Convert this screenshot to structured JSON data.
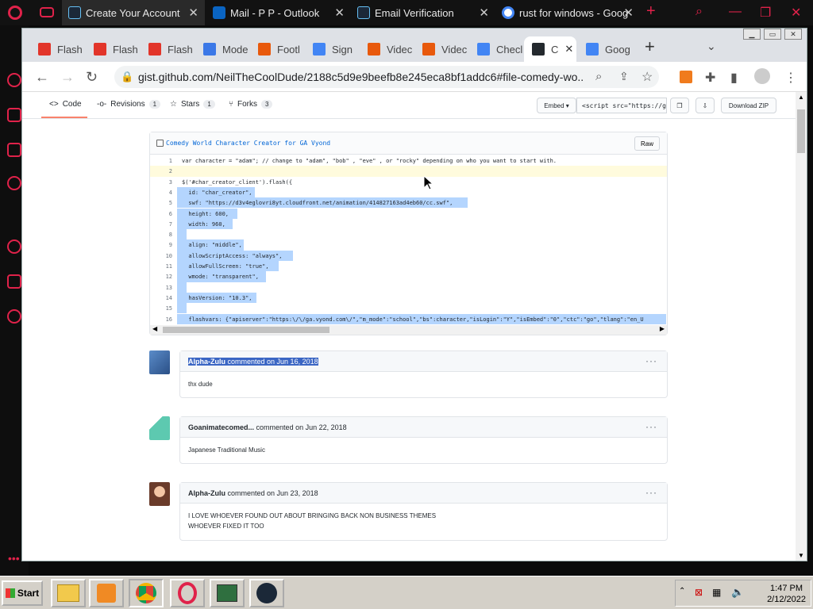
{
  "opera": {
    "tabs": [
      {
        "title": "Create Your Account",
        "favicon": "steam-icon",
        "active": true
      },
      {
        "title": "Mail - P P - Outlook",
        "favicon": "outlook-icon"
      },
      {
        "title": "Email Verification",
        "favicon": "steam-icon"
      },
      {
        "title": "rust for windows - Goog",
        "favicon": "google-icon"
      }
    ],
    "new_tab": "+"
  },
  "chrome": {
    "tabs": [
      {
        "title": "Flash",
        "favicon": "flash-icon",
        "color": "#e2352a"
      },
      {
        "title": "Flash",
        "favicon": "flash-icon",
        "color": "#e2352a"
      },
      {
        "title": "Flash",
        "favicon": "flash-icon",
        "color": "#e2352a"
      },
      {
        "title": "Mode",
        "favicon": "m-icon",
        "color": "#3b78e7"
      },
      {
        "title": "Footl",
        "favicon": "m-icon",
        "color": "#e8590c"
      },
      {
        "title": "Sign",
        "favicon": "google-icon",
        "color": "#4285f4"
      },
      {
        "title": "Videc",
        "favicon": "v-icon",
        "color": "#e8590c"
      },
      {
        "title": "Videc",
        "favicon": "v-icon",
        "color": "#e8590c"
      },
      {
        "title": "Checl",
        "favicon": "google-icon",
        "color": "#4285f4"
      },
      {
        "title": "C",
        "favicon": "github-icon",
        "color": "#24292e",
        "active": true
      },
      {
        "title": "Goog",
        "favicon": "google-icon",
        "color": "#4285f4"
      }
    ],
    "url": "gist.github.com/NeilTheCoolDude/2188c5d9e9beefb8e245eca8bf1addc6#file-comedy-wo..."
  },
  "gist": {
    "nav": {
      "code": "Code",
      "revisions": "Revisions",
      "revisions_count": "1",
      "stars": "Stars",
      "stars_count": "1",
      "forks": "Forks",
      "forks_count": "3"
    },
    "embed_label": "Embed",
    "embed_value": "<script src=\"https://gi",
    "download_label": "Download ZIP",
    "file_name": "Comedy World Character Creator for GA Vyond",
    "raw_label": "Raw",
    "code_lines": [
      {
        "n": "1",
        "text": "var character = \"adam\"; // change to \"adam\", \"bob\" , \"eve\" , or \"rocky\" depending on who you want to start with.",
        "state": "plain"
      },
      {
        "n": "2",
        "text": "",
        "state": "highlight"
      },
      {
        "n": "3",
        "text": "$('#char_creator_client').flash({",
        "state": "plain"
      },
      {
        "n": "4",
        "text": "  id: \"char_creator\",",
        "state": "selected"
      },
      {
        "n": "5",
        "text": "  swf: \"https://d3v4eglovri8yt.cloudfront.net/animation/414827163ad4eb60/cc.swf\",",
        "state": "selected"
      },
      {
        "n": "6",
        "text": "  height: 600,",
        "state": "selected"
      },
      {
        "n": "7",
        "text": "  width: 960,",
        "state": "selected"
      },
      {
        "n": "8",
        "text": "",
        "state": "selected"
      },
      {
        "n": "9",
        "text": "  align: \"middle\",",
        "state": "selected"
      },
      {
        "n": "10",
        "text": "  allowScriptAccess: \"always\",",
        "state": "selected"
      },
      {
        "n": "11",
        "text": "  allowFullScreen: \"true\",",
        "state": "selected"
      },
      {
        "n": "12",
        "text": "  wmode: \"transparent\",",
        "state": "selected"
      },
      {
        "n": "13",
        "text": "",
        "state": "selected"
      },
      {
        "n": "14",
        "text": "  hasVersion: \"10.3\",",
        "state": "selected"
      },
      {
        "n": "15",
        "text": "",
        "state": "selected"
      },
      {
        "n": "16",
        "text": "  flashvars: {\"apiserver\":\"https:\\/\\/ga.vyond.com\\/\",\"m_mode\":\"school\",\"bs\":character,\"isLogin\":\"Y\",\"isEmbed\":\"0\",\"ctc\":\"go\",\"tlang\":\"en_U",
        "state": "selected"
      }
    ],
    "comments": [
      {
        "author": "Alpha-Zulu",
        "action": "commented on Jun 16, 2018",
        "body": [
          "thx dude"
        ],
        "selected": true
      },
      {
        "author": "Goanimatecomed...",
        "action": "commented on Jun 22, 2018",
        "body": [
          "Japanese Traditional Music"
        ]
      },
      {
        "author": "Alpha-Zulu",
        "action": "commented on Jun 23, 2018",
        "body": [
          "I LOVE WHOEVER FOUND OUT ABOUT BRINGING BACK NON BUSINESS THEMES",
          "WHOEVER FIXED IT TOO"
        ]
      }
    ]
  },
  "taskbar": {
    "start": "Start",
    "time": "1:47 PM",
    "date": "2/12/2022"
  },
  "colors": {
    "opera_accent": "#e0224a",
    "selection": "#b4d5fe",
    "link": "#0366d6"
  }
}
